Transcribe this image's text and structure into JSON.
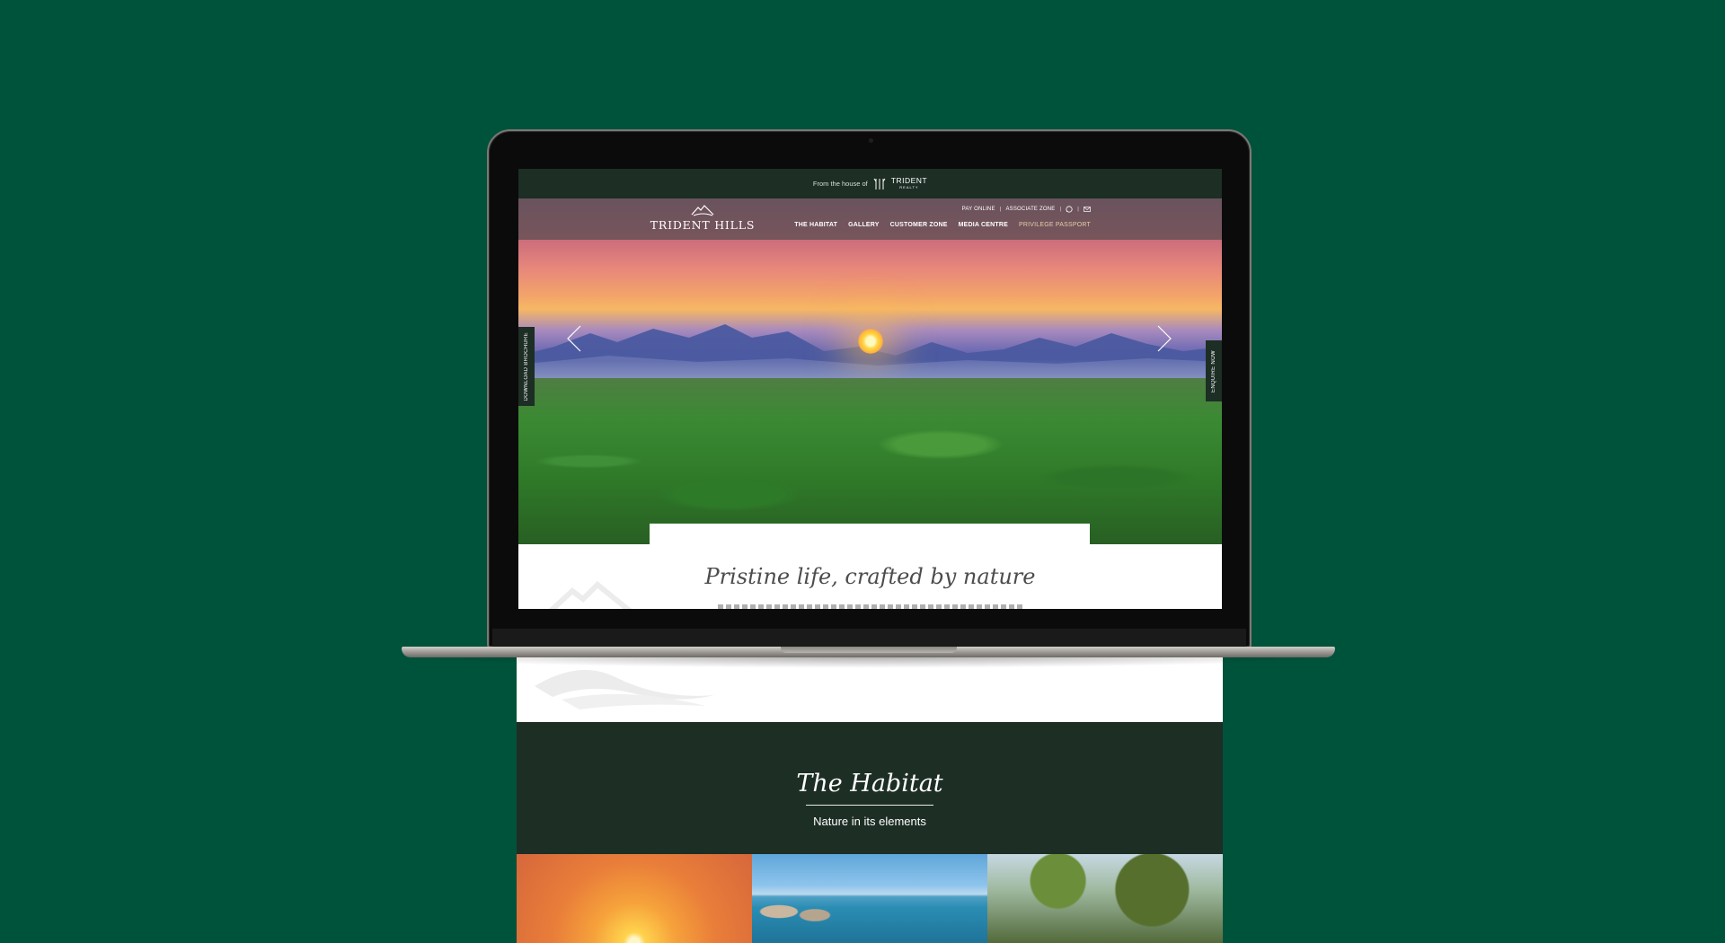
{
  "colors": {
    "background": "#00533b",
    "brand_dark_green": "#1d2e25",
    "nav_highlight": "#e2cfa8"
  },
  "topbar": {
    "prefix": "From the house of",
    "logo_text": "TRIDENT",
    "logo_subtext": "REALTY"
  },
  "brand": {
    "name": "TRIDENT HILLS",
    "icon": "mountain-logo-icon"
  },
  "utility_links": {
    "pay_online": "PAY ONLINE",
    "associate_zone": "ASSOCIATE ZONE",
    "separator": "|",
    "icons": [
      "whatsapp-icon",
      "mail-icon"
    ]
  },
  "main_nav": {
    "items": [
      {
        "label": "THE HABITAT"
      },
      {
        "label": "GALLERY"
      },
      {
        "label": "CUSTOMER ZONE"
      },
      {
        "label": "MEDIA CENTRE"
      },
      {
        "label": "PRIVILEGE PASSPORT"
      }
    ]
  },
  "hero": {
    "image": "sunset-over-mountains-and-forest",
    "prev_icon": "chevron-left-icon",
    "next_icon": "chevron-right-icon"
  },
  "side_tabs": {
    "left": "DOWNLOAD BROCHURE",
    "right": "ENQUIRE NOW"
  },
  "intro": {
    "title": "Pristine life, crafted by nature"
  },
  "habitat": {
    "title": "The Habitat",
    "subtitle": "Nature in its elements",
    "tiles": [
      "sunset-tile",
      "lake-tile",
      "trees-tile"
    ]
  }
}
